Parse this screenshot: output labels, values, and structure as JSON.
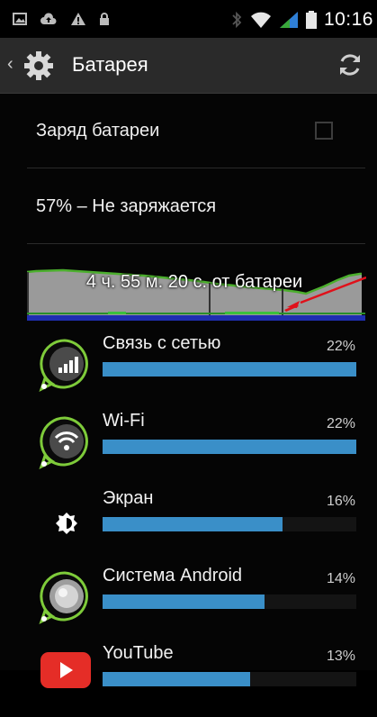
{
  "status_bar": {
    "time": "10:16"
  },
  "header": {
    "title": "Батарея"
  },
  "battery": {
    "charge_label": "Заряд батареи",
    "status": "57% – Не заряжается",
    "graph_label": "4 ч. 55 м. 20 с. от батареи"
  },
  "apps": [
    {
      "name": "Связь с сетью",
      "percent": "22%",
      "fraction": 1.0
    },
    {
      "name": "Wi-Fi",
      "percent": "22%",
      "fraction": 1.0
    },
    {
      "name": "Экран",
      "percent": "16%",
      "fraction": 0.71
    },
    {
      "name": "Система Android",
      "percent": "14%",
      "fraction": 0.64
    },
    {
      "name": "YouTube",
      "percent": "13%",
      "fraction": 0.58
    }
  ],
  "colors": {
    "bar": "#3a8fc8",
    "graph_line": "#4caf2e",
    "graph_fill": "#9a9a9a",
    "graph_base": "#1f2fb0",
    "arrow": "#e0101a"
  }
}
